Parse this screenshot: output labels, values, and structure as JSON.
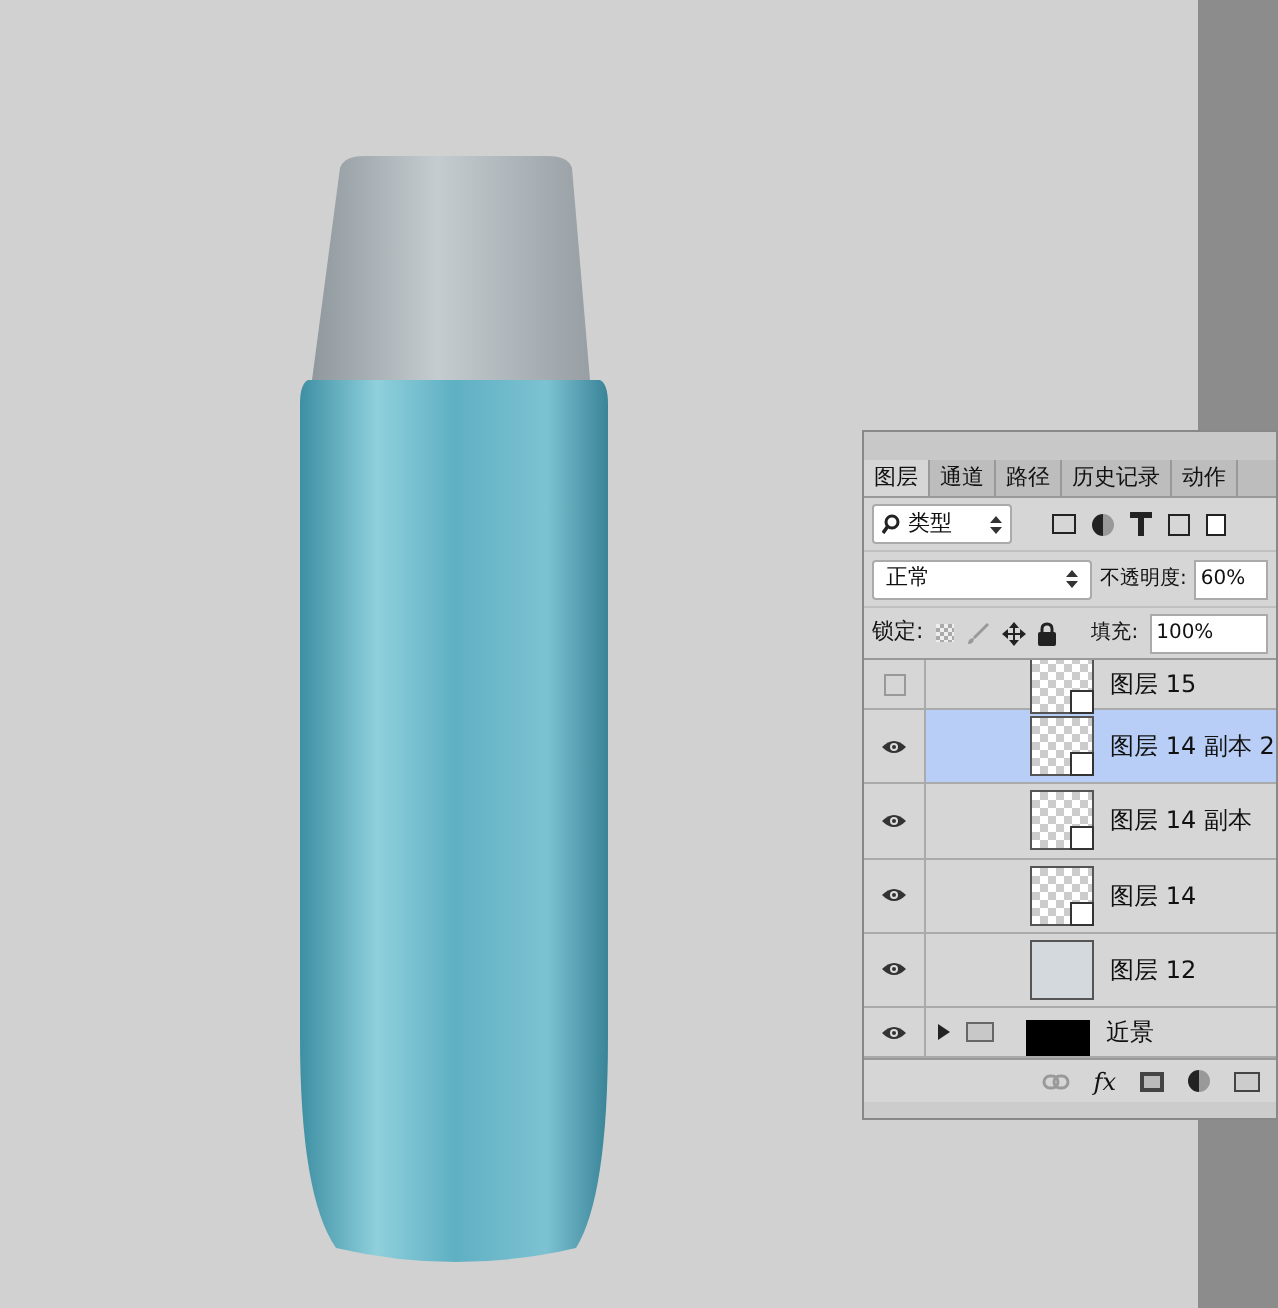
{
  "layers_panel": {
    "tabs": [
      {
        "label": "图层",
        "selected": true
      },
      {
        "label": "通道",
        "selected": false
      },
      {
        "label": "路径",
        "selected": false
      },
      {
        "label": "历史记录",
        "selected": false
      },
      {
        "label": "动作",
        "selected": false
      }
    ],
    "filter": {
      "value": "类型"
    },
    "blend_mode": {
      "value": "正常"
    },
    "opacity": {
      "label": "不透明度:",
      "value": "60%"
    },
    "lock": {
      "label": "锁定:"
    },
    "fill": {
      "label": "填充:",
      "value": "100%"
    },
    "footer": {
      "effects_label": "fx"
    },
    "layers": [
      {
        "name": "图层 15",
        "kind": "smart",
        "visible": false,
        "selected": false
      },
      {
        "name": "图层 14 副本 2",
        "kind": "smart",
        "visible": true,
        "selected": true
      },
      {
        "name": "图层 14 副本",
        "kind": "smart",
        "visible": true,
        "selected": false
      },
      {
        "name": "图层 14",
        "kind": "smart",
        "visible": true,
        "selected": false
      },
      {
        "name": "图层 12",
        "kind": "fill",
        "visible": true,
        "selected": false
      },
      {
        "name": "近景",
        "kind": "group",
        "visible": true,
        "selected": false,
        "expanded": false
      }
    ]
  }
}
